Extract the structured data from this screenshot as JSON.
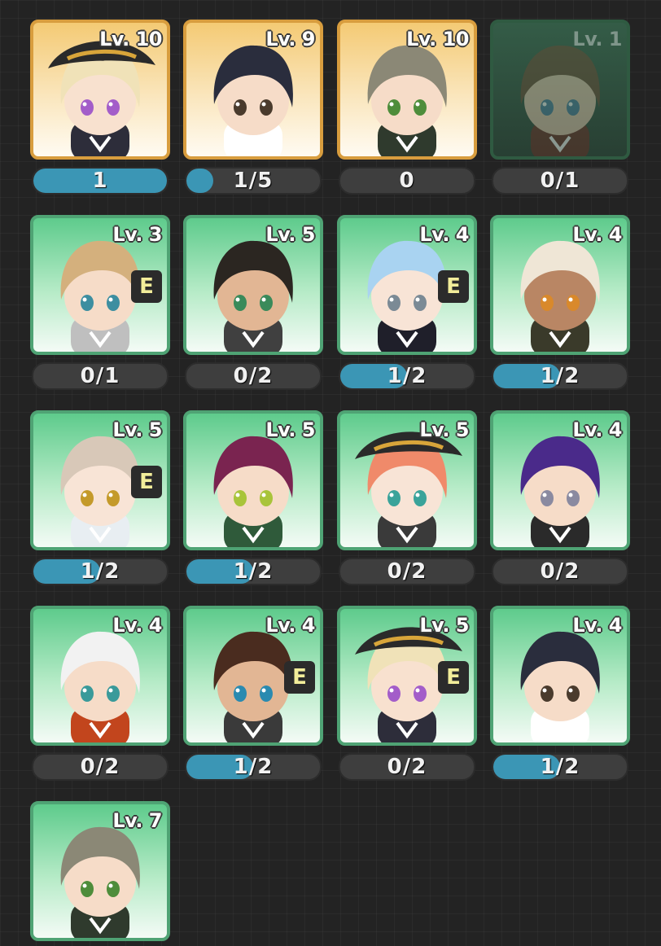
{
  "colors": {
    "background": "#232323",
    "card_border_green": "#4fa374",
    "card_border_gold": "#d89d3e",
    "card_border_locked": "#2f5a41",
    "progress_fill": "#3b96b5",
    "progress_track": "#3e3e3e",
    "elite_badge_text": "#f2ed9a"
  },
  "characters": [
    {
      "level": "Lv. 10",
      "progress": "1",
      "fill": 1.0,
      "frame": "gold",
      "elite": false,
      "hair": "#f0e2b8",
      "hat": true,
      "eye": "#a35dc9",
      "outfit": "#2d2d3a",
      "skin": "#f8e1cf"
    },
    {
      "level": "Lv. 9",
      "progress": "1/5",
      "fill": 0.2,
      "frame": "gold",
      "elite": false,
      "hair": "#2a2d3d",
      "hat": false,
      "eye": "#4a3b2d",
      "outfit": "#ffffff",
      "skin": "#f6dcc8"
    },
    {
      "level": "Lv. 10",
      "progress": "0",
      "fill": 0.0,
      "frame": "gold",
      "elite": false,
      "hair": "#8b8876",
      "hat": false,
      "eye": "#4e8d3b",
      "outfit": "#2f3a2d",
      "skin": "#f6dcc8"
    },
    {
      "level": "Lv. 1",
      "progress": "0/1",
      "fill": 0.0,
      "frame": "locked",
      "elite": false,
      "hair": "#6b4a34",
      "hat": false,
      "eye": "#4a7fa0",
      "outfit": "#6b2d24",
      "skin": "#e8c9b0"
    },
    {
      "level": "Lv. 3",
      "progress": "0/1",
      "fill": 0.0,
      "frame": "green",
      "elite": true,
      "hair": "#d4b07d",
      "hat": false,
      "eye": "#3d8ea0",
      "outfit": "#bfbfbf",
      "skin": "#f6dcc8"
    },
    {
      "level": "Lv. 5",
      "progress": "0/2",
      "fill": 0.0,
      "frame": "green",
      "elite": false,
      "hair": "#2b2621",
      "hat": false,
      "eye": "#3a8a5a",
      "outfit": "#404040",
      "skin": "#e2b694"
    },
    {
      "level": "Lv. 4",
      "progress": "1/2",
      "fill": 0.5,
      "frame": "green",
      "elite": true,
      "hair": "#a9d3f1",
      "hat": false,
      "eye": "#7b8a95",
      "outfit": "#1f1f2a",
      "skin": "#f8e4d6"
    },
    {
      "level": "Lv. 4",
      "progress": "1/2",
      "fill": 0.5,
      "frame": "green",
      "elite": false,
      "hair": "#efe6d6",
      "hat": false,
      "eye": "#d9892b",
      "outfit": "#3a3a2a",
      "skin": "#b98664"
    },
    {
      "level": "Lv. 5",
      "progress": "1/2",
      "fill": 0.5,
      "frame": "green",
      "elite": true,
      "hair": "#d8c8b8",
      "hat": false,
      "eye": "#c49a2a",
      "outfit": "#e8eef2",
      "skin": "#f8e4d6"
    },
    {
      "level": "Lv. 5",
      "progress": "1/2",
      "fill": 0.5,
      "frame": "green",
      "elite": false,
      "hair": "#7a2450",
      "hat": false,
      "eye": "#a8c43a",
      "outfit": "#2f5a3a",
      "skin": "#f6dcc8"
    },
    {
      "level": "Lv. 5",
      "progress": "0/2",
      "fill": 0.0,
      "frame": "green",
      "elite": false,
      "hair": "#f08a6a",
      "hat": true,
      "eye": "#3aa39a",
      "outfit": "#3a3a3a",
      "skin": "#f8e4d6"
    },
    {
      "level": "Lv. 4",
      "progress": "0/2",
      "fill": 0.0,
      "frame": "green",
      "elite": false,
      "hair": "#4a2a8a",
      "hat": false,
      "eye": "#8a8aa0",
      "outfit": "#2a2a2a",
      "skin": "#f6dcc8"
    },
    {
      "level": "Lv. 4",
      "progress": "0/2",
      "fill": 0.0,
      "frame": "green",
      "elite": false,
      "hair": "#f2f2f2",
      "hat": false,
      "eye": "#3a9a9a",
      "outfit": "#c2451d",
      "skin": "#f6dcc8"
    },
    {
      "level": "Lv. 4",
      "progress": "1/2",
      "fill": 0.5,
      "frame": "green",
      "elite": true,
      "hair": "#4a2c1f",
      "hat": false,
      "eye": "#2a8ab0",
      "outfit": "#3a3a3a",
      "skin": "#e2b694"
    },
    {
      "level": "Lv. 5",
      "progress": "0/2",
      "fill": 0.0,
      "frame": "green",
      "elite": true,
      "hair": "#f0e2b8",
      "hat": true,
      "eye": "#a35dc9",
      "outfit": "#2d2d3a",
      "skin": "#f8e1cf"
    },
    {
      "level": "Lv. 4",
      "progress": "1/2",
      "fill": 0.5,
      "frame": "green",
      "elite": false,
      "hair": "#2a2d3d",
      "hat": false,
      "eye": "#4a3b2d",
      "outfit": "#ffffff",
      "skin": "#f6dcc8"
    },
    {
      "level": "Lv. 7",
      "progress": "",
      "fill": 0.0,
      "frame": "green",
      "elite": false,
      "hair": "#8b8876",
      "hat": false,
      "eye": "#4e8d3b",
      "outfit": "#2f3a2d",
      "skin": "#f6dcc8"
    }
  ],
  "elite_badge": "E"
}
